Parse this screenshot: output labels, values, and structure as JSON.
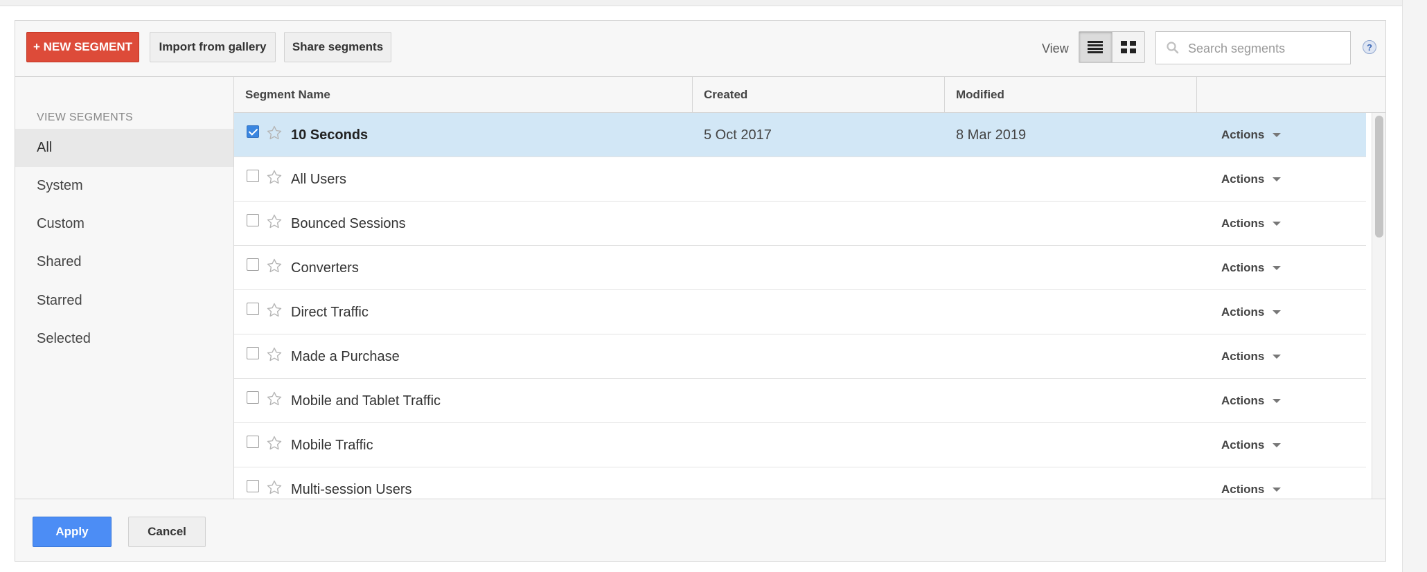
{
  "toolbar": {
    "new_segment_label": "+ NEW SEGMENT",
    "import_label": "Import from gallery",
    "share_label": "Share segments",
    "view_label": "View",
    "search_placeholder": "Search segments",
    "help_label": "?"
  },
  "sidebar": {
    "heading": "VIEW SEGMENTS",
    "items": [
      {
        "label": "All",
        "active": true
      },
      {
        "label": "System"
      },
      {
        "label": "Custom"
      },
      {
        "label": "Shared"
      },
      {
        "label": "Starred"
      },
      {
        "label": "Selected"
      }
    ]
  },
  "table": {
    "columns": [
      "Segment Name",
      "Created",
      "Modified"
    ],
    "rows": [
      {
        "name": "10 Seconds",
        "created": "5 Oct 2017",
        "modified": "8 Mar 2019",
        "checked": true,
        "actions": "Actions"
      },
      {
        "name": "All Users",
        "created": "",
        "modified": "",
        "checked": false,
        "actions": "Actions"
      },
      {
        "name": "Bounced Sessions",
        "created": "",
        "modified": "",
        "checked": false,
        "actions": "Actions"
      },
      {
        "name": "Converters",
        "created": "",
        "modified": "",
        "checked": false,
        "actions": "Actions"
      },
      {
        "name": "Direct Traffic",
        "created": "",
        "modified": "",
        "checked": false,
        "actions": "Actions"
      },
      {
        "name": "Made a Purchase",
        "created": "",
        "modified": "",
        "checked": false,
        "actions": "Actions"
      },
      {
        "name": "Mobile and Tablet Traffic",
        "created": "",
        "modified": "",
        "checked": false,
        "actions": "Actions"
      },
      {
        "name": "Mobile Traffic",
        "created": "",
        "modified": "",
        "checked": false,
        "actions": "Actions"
      },
      {
        "name": "Multi-session Users",
        "created": "",
        "modified": "",
        "checked": false,
        "actions": "Actions"
      }
    ]
  },
  "footer": {
    "apply_label": "Apply",
    "cancel_label": "Cancel"
  },
  "colors": {
    "new_segment": "#dd4b39",
    "apply": "#4c8df5",
    "selected_row": "#d2e7f6",
    "checkbox_checked": "#3a86e0"
  },
  "icons": {
    "search": "search-icon",
    "list_view": "list-view-icon",
    "grid_view": "grid-view-icon",
    "star": "star-outline-icon",
    "caret": "caret-down-icon",
    "help": "help-icon"
  }
}
